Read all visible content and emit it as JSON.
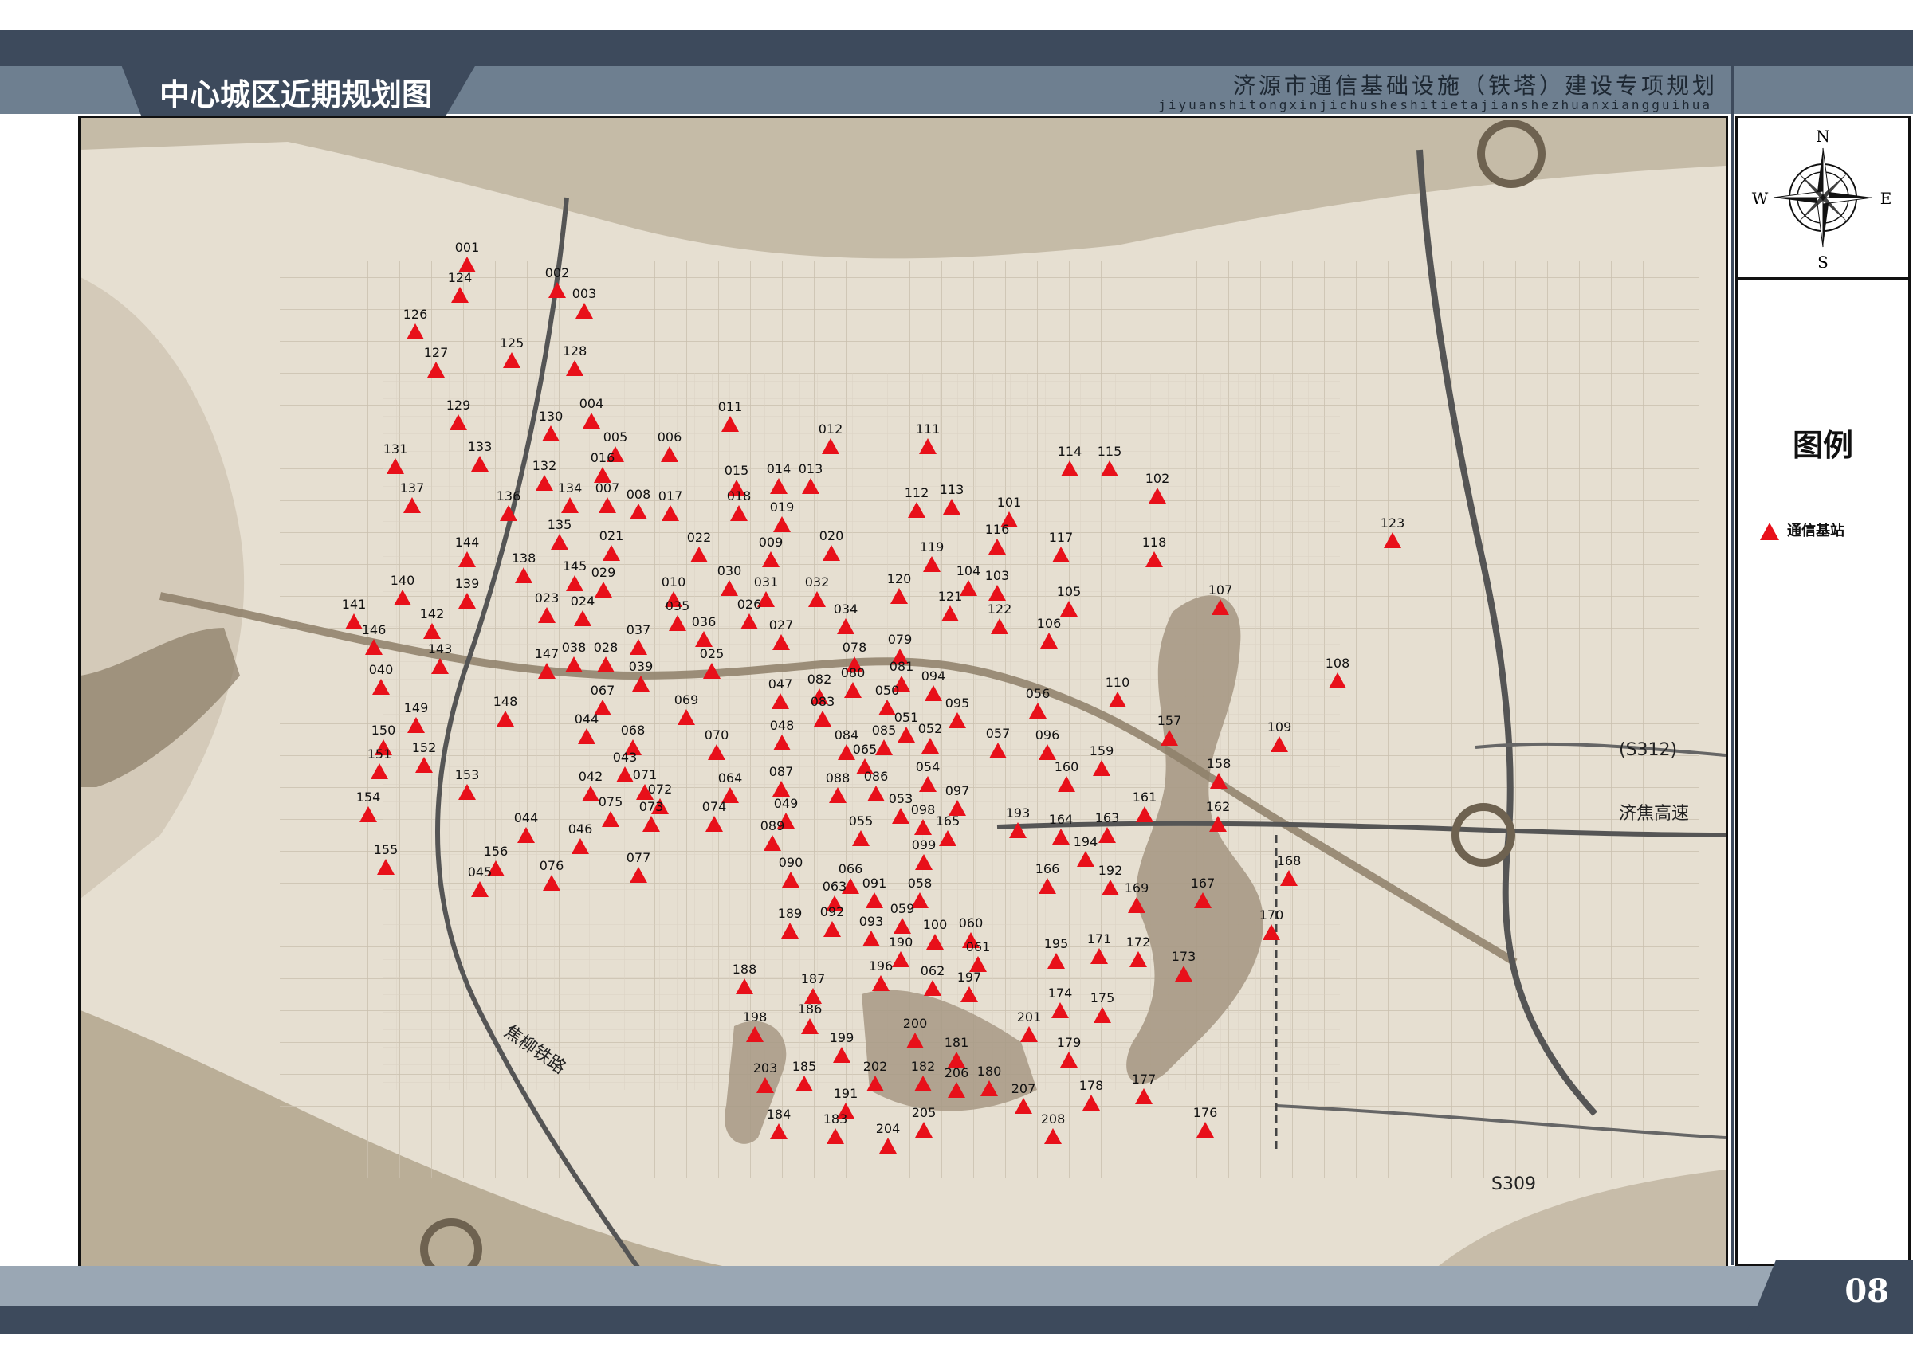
{
  "header": {
    "map_title": "中心城区近期规划图",
    "project_title": "济源市通信基础设施（铁塔）建设专项规划",
    "project_pinyin": "jiyuanshitongxinjichusheshitietajianshezhuanxiangguihua"
  },
  "compass": {
    "n": "N",
    "s": "S",
    "e": "E",
    "w": "W"
  },
  "legend": {
    "title": "图例",
    "items": [
      {
        "label": "通信基站",
        "symbol": "red-triangle",
        "color": "#e8101a"
      }
    ]
  },
  "road_labels": {
    "railway": "焦柳铁路",
    "expressway": "济焦高速",
    "s312": "(S312)",
    "s309": "S309"
  },
  "footer": {
    "page_number": "08"
  },
  "sites": [
    "001",
    "124",
    "002",
    "003",
    "126",
    "125",
    "127",
    "128",
    "129",
    "004",
    "130",
    "011",
    "012",
    "111",
    "005",
    "006",
    "133",
    "131",
    "016",
    "015",
    "014",
    "013",
    "114",
    "115",
    "132",
    "102",
    "137",
    "136",
    "134",
    "007",
    "008",
    "017",
    "018",
    "112",
    "113",
    "101",
    "135",
    "019",
    "009",
    "021",
    "022",
    "020",
    "116",
    "117",
    "118",
    "123",
    "144",
    "138",
    "145",
    "029",
    "030",
    "010",
    "031",
    "032",
    "120",
    "119",
    "104",
    "103",
    "140",
    "139",
    "023",
    "024",
    "035",
    "026",
    "036",
    "121",
    "122",
    "105",
    "107",
    "141",
    "142",
    "146",
    "037",
    "027",
    "034",
    "106",
    "143",
    "038",
    "028",
    "078",
    "079",
    "025",
    "147",
    "039",
    "081",
    "040",
    "080",
    "094",
    "110",
    "108",
    "082",
    "047",
    "050",
    "067",
    "069",
    "056",
    "148",
    "149",
    "083",
    "095",
    "051",
    "157",
    "109",
    "044",
    "068",
    "048",
    "084",
    "085",
    "052",
    "057",
    "096",
    "150",
    "070",
    "152",
    "065",
    "159",
    "158",
    "151",
    "043",
    "087",
    "054",
    "086",
    "160",
    "042",
    "071",
    "088",
    "064",
    "097",
    "072",
    "161",
    "153",
    "154",
    "075",
    "049",
    "053",
    "074",
    "073",
    "098",
    "193",
    "164",
    "163",
    "162",
    "044b",
    "089",
    "055",
    "165",
    "046",
    "099",
    "194",
    "156",
    "155",
    "076",
    "168",
    "077",
    "090",
    "066",
    "166",
    "192",
    "045",
    "063",
    "091",
    "058",
    "167",
    "169",
    "189",
    "092",
    "093",
    "059",
    "060",
    "170",
    "100",
    "061",
    "190",
    "195",
    "171",
    "172",
    "173",
    "188",
    "187",
    "196",
    "062",
    "197",
    "174",
    "175",
    "186",
    "198",
    "201",
    "200",
    "179",
    "181",
    "199",
    "202",
    "182",
    "206",
    "180",
    "207",
    "178",
    "177",
    "203",
    "185",
    "191",
    "205",
    "184",
    "183",
    "204",
    "208",
    "176"
  ]
}
